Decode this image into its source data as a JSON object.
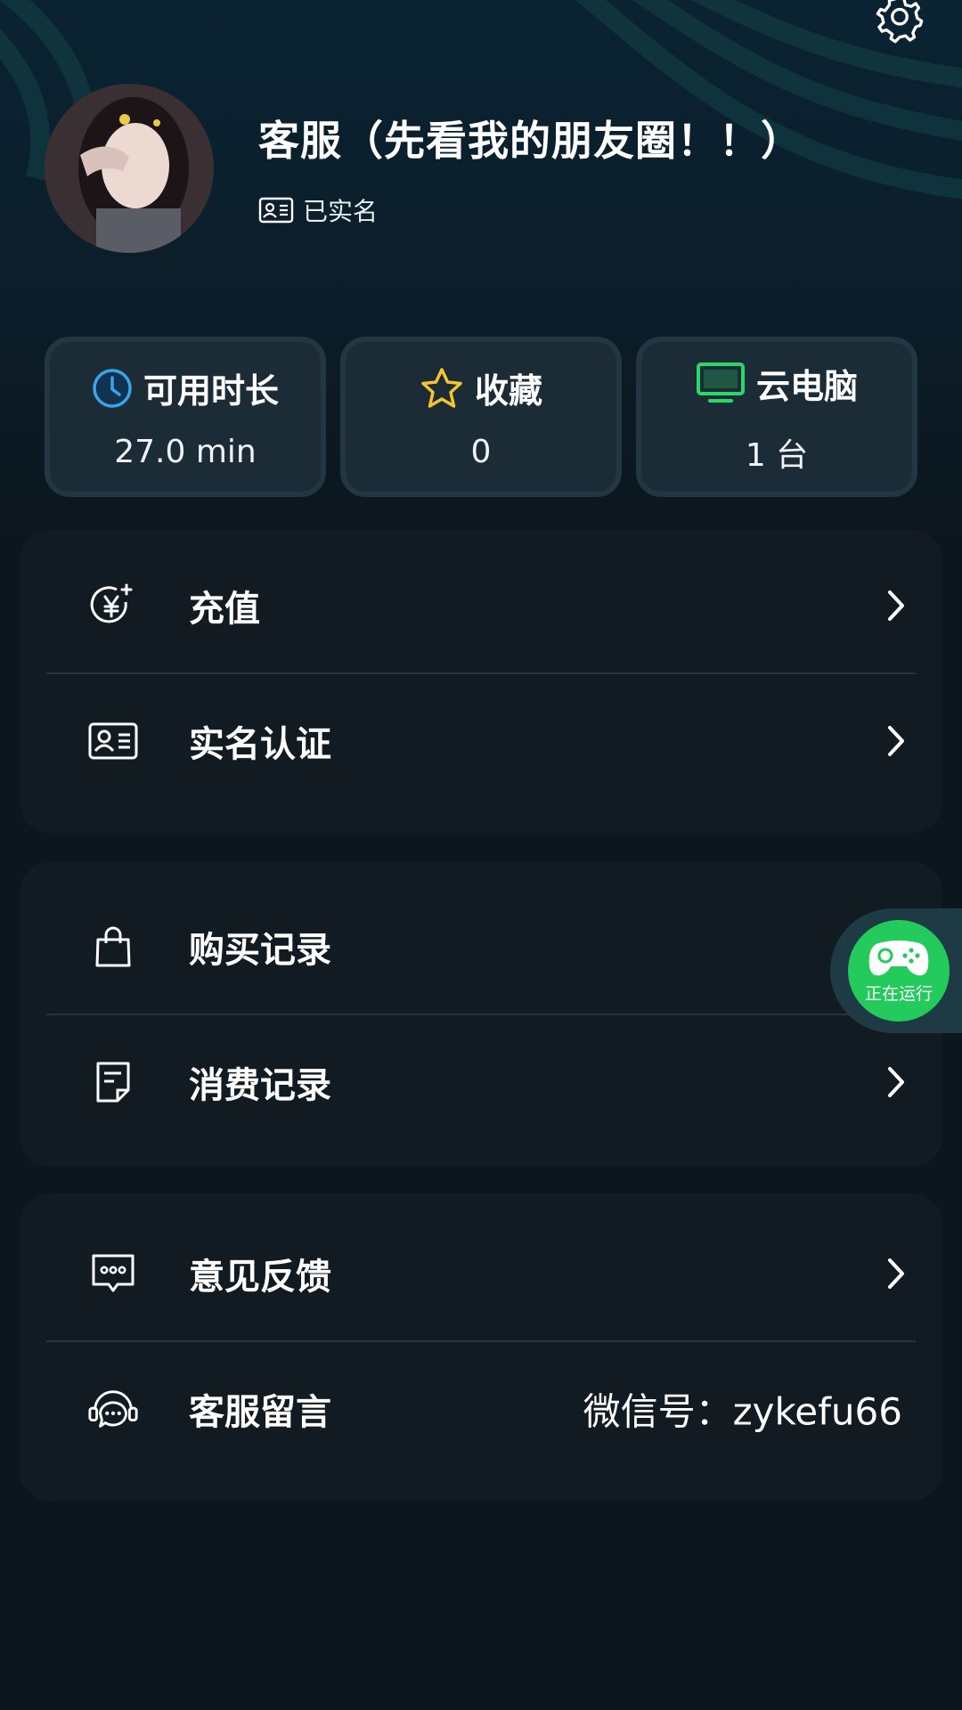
{
  "profile": {
    "username": "客服（先看我的朋友圈！！）",
    "verified_label": "已实名"
  },
  "stats": [
    {
      "label": "可用时长",
      "value": "27.0 min",
      "icon": "clock-icon",
      "color": "#3da3e8"
    },
    {
      "label": "收藏",
      "value": "0",
      "icon": "star-icon",
      "color": "#f2c531"
    },
    {
      "label": "云电脑",
      "value": "1 台",
      "icon": "monitor-icon",
      "color": "#2bd66a"
    }
  ],
  "menu": {
    "recharge": "充值",
    "real_name": "实名认证",
    "purchase_records": "购买记录",
    "consume_records": "消费记录",
    "feedback": "意见反馈",
    "service_message": "客服留言",
    "wechat": "微信号：zykefu66"
  },
  "floating": {
    "label": "正在运行",
    "color": "#22cb5c"
  }
}
